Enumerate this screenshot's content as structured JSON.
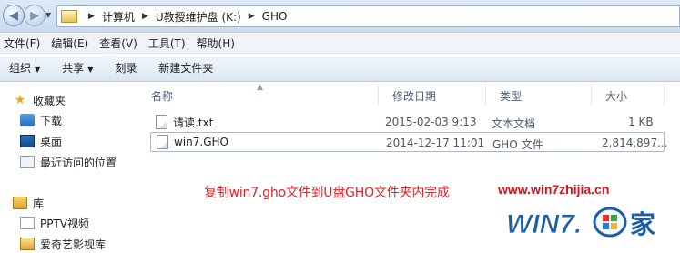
{
  "address": {
    "crumbs": [
      "计算机",
      "U教授维护盘 (K:)",
      "GHO"
    ]
  },
  "menu": [
    "文件(F)",
    "编辑(E)",
    "查看(V)",
    "工具(T)",
    "帮助(H)"
  ],
  "toolbar": {
    "organize": "组织",
    "share": "共享",
    "burn": "刻录",
    "new_folder": "新建文件夹"
  },
  "nav": {
    "favorites": "收藏夹",
    "download": "下载",
    "desktop": "桌面",
    "recent": "最近访问的位置",
    "library": "库",
    "pptv": "PPTV视频",
    "iqiyi": "爱奇艺影视库"
  },
  "columns": {
    "name": "名称",
    "date": "修改日期",
    "type": "类型",
    "size": "大小"
  },
  "files": [
    {
      "name": "请读.txt",
      "date": "2015-02-03 9:13",
      "type": "文本文档",
      "size": "1 KB"
    },
    {
      "name": "win7.GHO",
      "date": "2014-12-17 11:01",
      "type": "GHO 文件",
      "size": "2,814,897..."
    }
  ],
  "caption": "复制win7.gho文件到U盘GHO文件夹内完成",
  "watermark": {
    "url": "www.win7zhijia.cn",
    "logo_text": "WIN7.",
    "logo_char": "家"
  }
}
